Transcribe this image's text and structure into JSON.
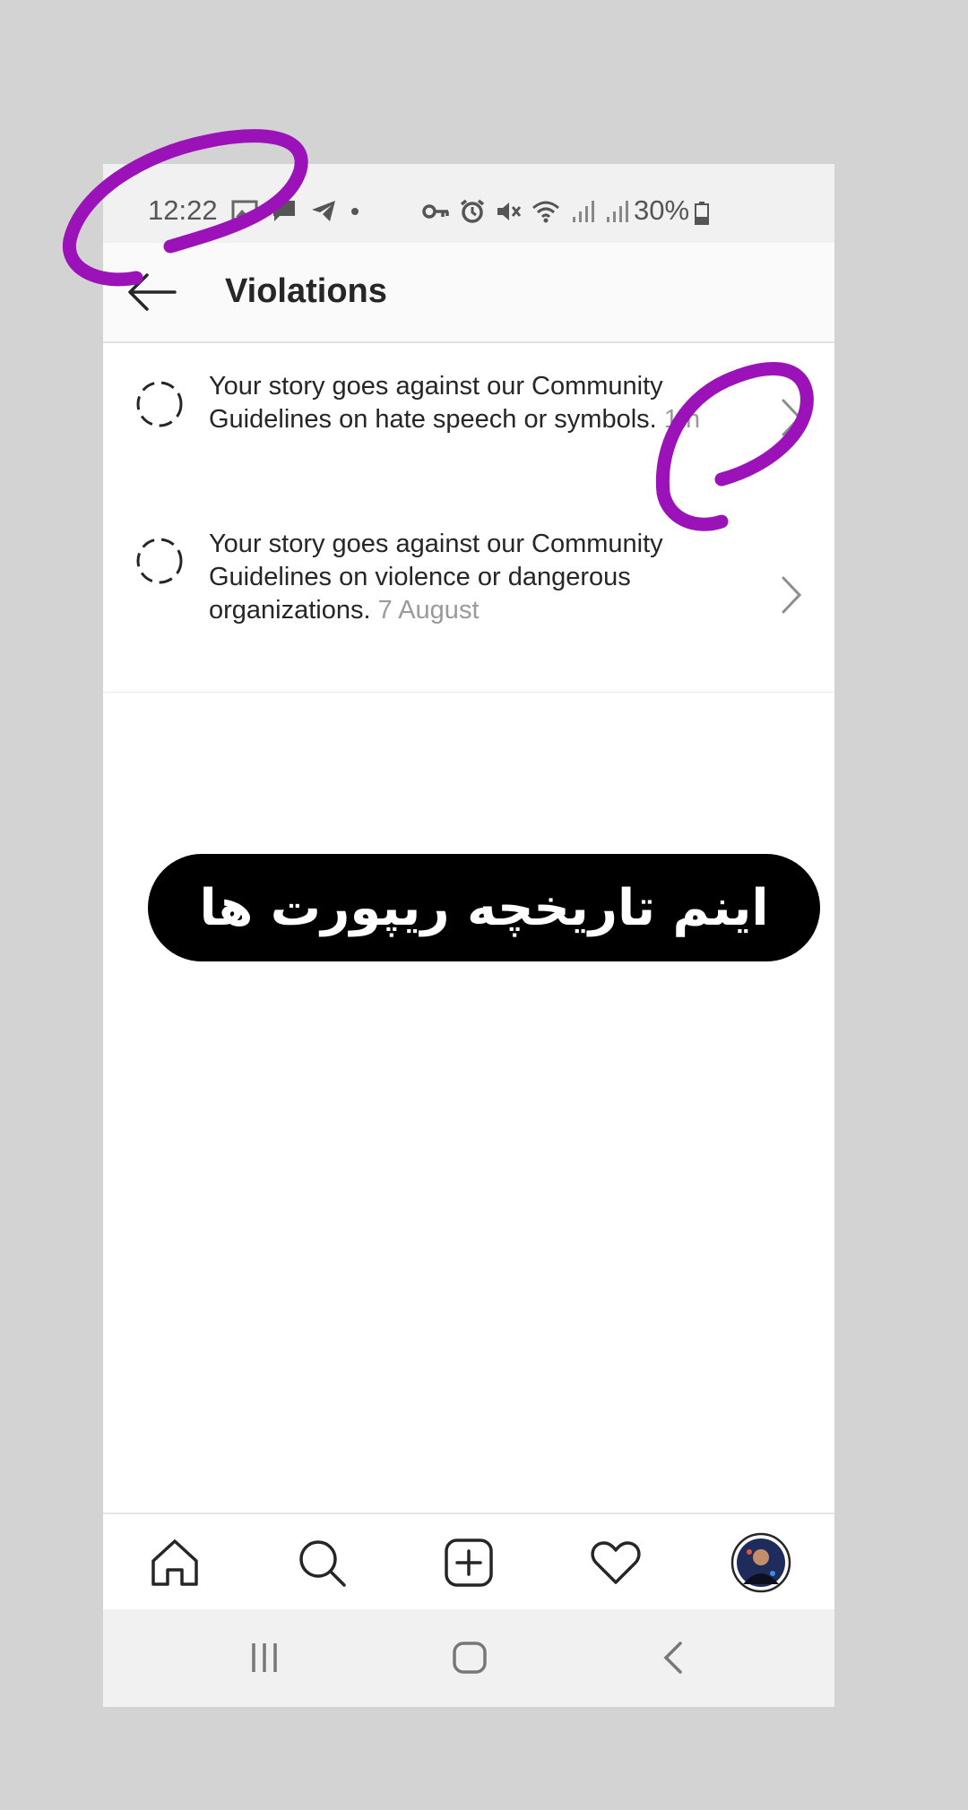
{
  "status_bar": {
    "time": "12:22",
    "battery": "30%",
    "icons": [
      "gallery-icon",
      "message-icon",
      "telegram-icon",
      "dot-icon",
      "vpn-key-icon",
      "alarm-icon",
      "mute-icon",
      "wifi-icon",
      "signal-icon",
      "signal-icon",
      "battery-icon"
    ]
  },
  "header": {
    "title": "Violations",
    "back_icon": "back-arrow-icon"
  },
  "violations": [
    {
      "text": "Your story goes against our Community Guidelines on hate speech or symbols.",
      "time": "1 h"
    },
    {
      "text": "Your story goes against our Community Guidelines on violence or dangerous organizations.",
      "time": "7 August"
    }
  ],
  "banner": {
    "text": "اینم تاریخچه ریپورت ها"
  },
  "bottom_nav": [
    "home-icon",
    "search-icon",
    "new-post-icon",
    "activity-heart-icon",
    "profile-avatar"
  ],
  "system_nav": [
    "recent-apps-icon",
    "home-button-icon",
    "back-icon"
  ],
  "colors": {
    "annotation_stroke": "#9b13b8",
    "background": "#d3d3d3",
    "timestamp": "#9a9a9a"
  }
}
